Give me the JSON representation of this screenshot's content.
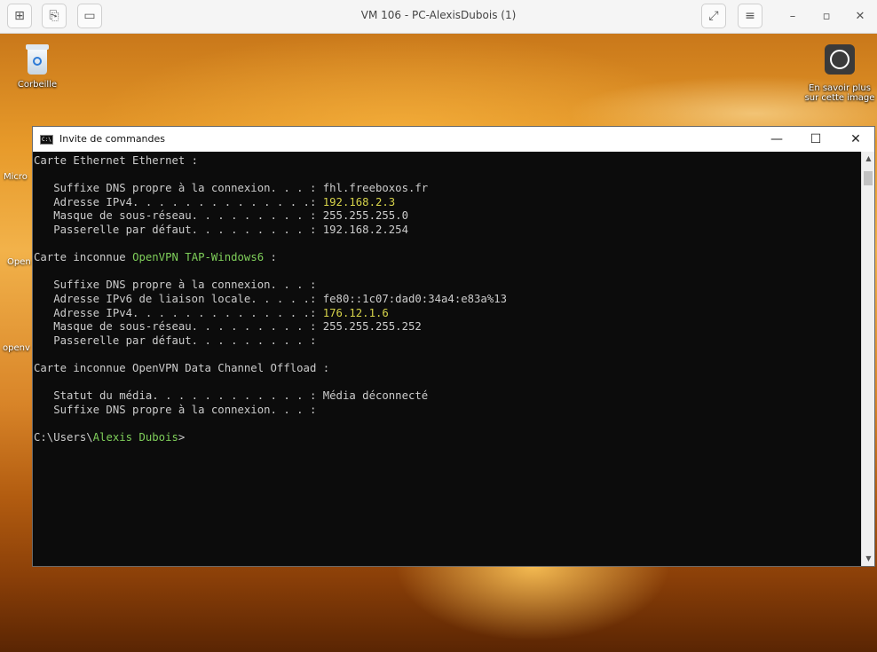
{
  "host": {
    "title": "VM 106 - PC-AlexisDubois (1)",
    "controls": {
      "minimize": "–",
      "restore": "▫",
      "close": "✕"
    }
  },
  "desktop": {
    "icons": {
      "recycle_bin": "Corbeille",
      "learn_more_line1": "En savoir plus",
      "learn_more_line2": "sur cette image"
    },
    "partial_labels": {
      "micro": "Micro",
      "open": "Open",
      "openv": "openv"
    }
  },
  "cmd": {
    "title": "Invite de commandes",
    "icon_text": "C:\\",
    "controls": {
      "minimize": "—",
      "maximize": "☐",
      "close": "✕"
    },
    "lines": [
      {
        "t": "Carte Ethernet Ethernet :"
      },
      {
        "t": ""
      },
      {
        "t": "   Suffixe DNS propre à la connexion. . . : ",
        "v": "fhl.freeboxos.fr"
      },
      {
        "t": "   Adresse IPv4. . . . . . . . . . . . . .: ",
        "h": "192.168.2.3"
      },
      {
        "t": "   Masque de sous-réseau. . . . . . . . . : ",
        "v": "255.255.255.0"
      },
      {
        "t": "   Passerelle par défaut. . . . . . . . . : ",
        "v": "192.168.2.254"
      },
      {
        "t": ""
      },
      {
        "t": "Carte inconnue ",
        "g": "OpenVPN TAP-Windows6",
        "a": " :"
      },
      {
        "t": ""
      },
      {
        "t": "   Suffixe DNS propre à la connexion. . . :"
      },
      {
        "t": "   Adresse IPv6 de liaison locale. . . . .: ",
        "v": "fe80::1c07:dad0:34a4:e83a%13"
      },
      {
        "t": "   Adresse IPv4. . . . . . . . . . . . . .: ",
        "h": "176.12.1.6"
      },
      {
        "t": "   Masque de sous-réseau. . . . . . . . . : ",
        "v": "255.255.255.252"
      },
      {
        "t": "   Passerelle par défaut. . . . . . . . . :"
      },
      {
        "t": ""
      },
      {
        "t": "Carte inconnue OpenVPN Data Channel Offload :"
      },
      {
        "t": ""
      },
      {
        "t": "   Statut du média. . . . . . . . . . . . : ",
        "v": "Média déconnecté"
      },
      {
        "t": "   Suffixe DNS propre à la connexion. . . :"
      },
      {
        "t": ""
      },
      {
        "t": "C:\\Users\\",
        "g": "Alexis Dubois",
        "a": ">"
      }
    ]
  },
  "colors": {
    "console_bg": "#0c0c0c",
    "console_text": "#cccccc",
    "highlight_yellow": "#d6d34a",
    "highlight_green": "#7fcf5a"
  }
}
